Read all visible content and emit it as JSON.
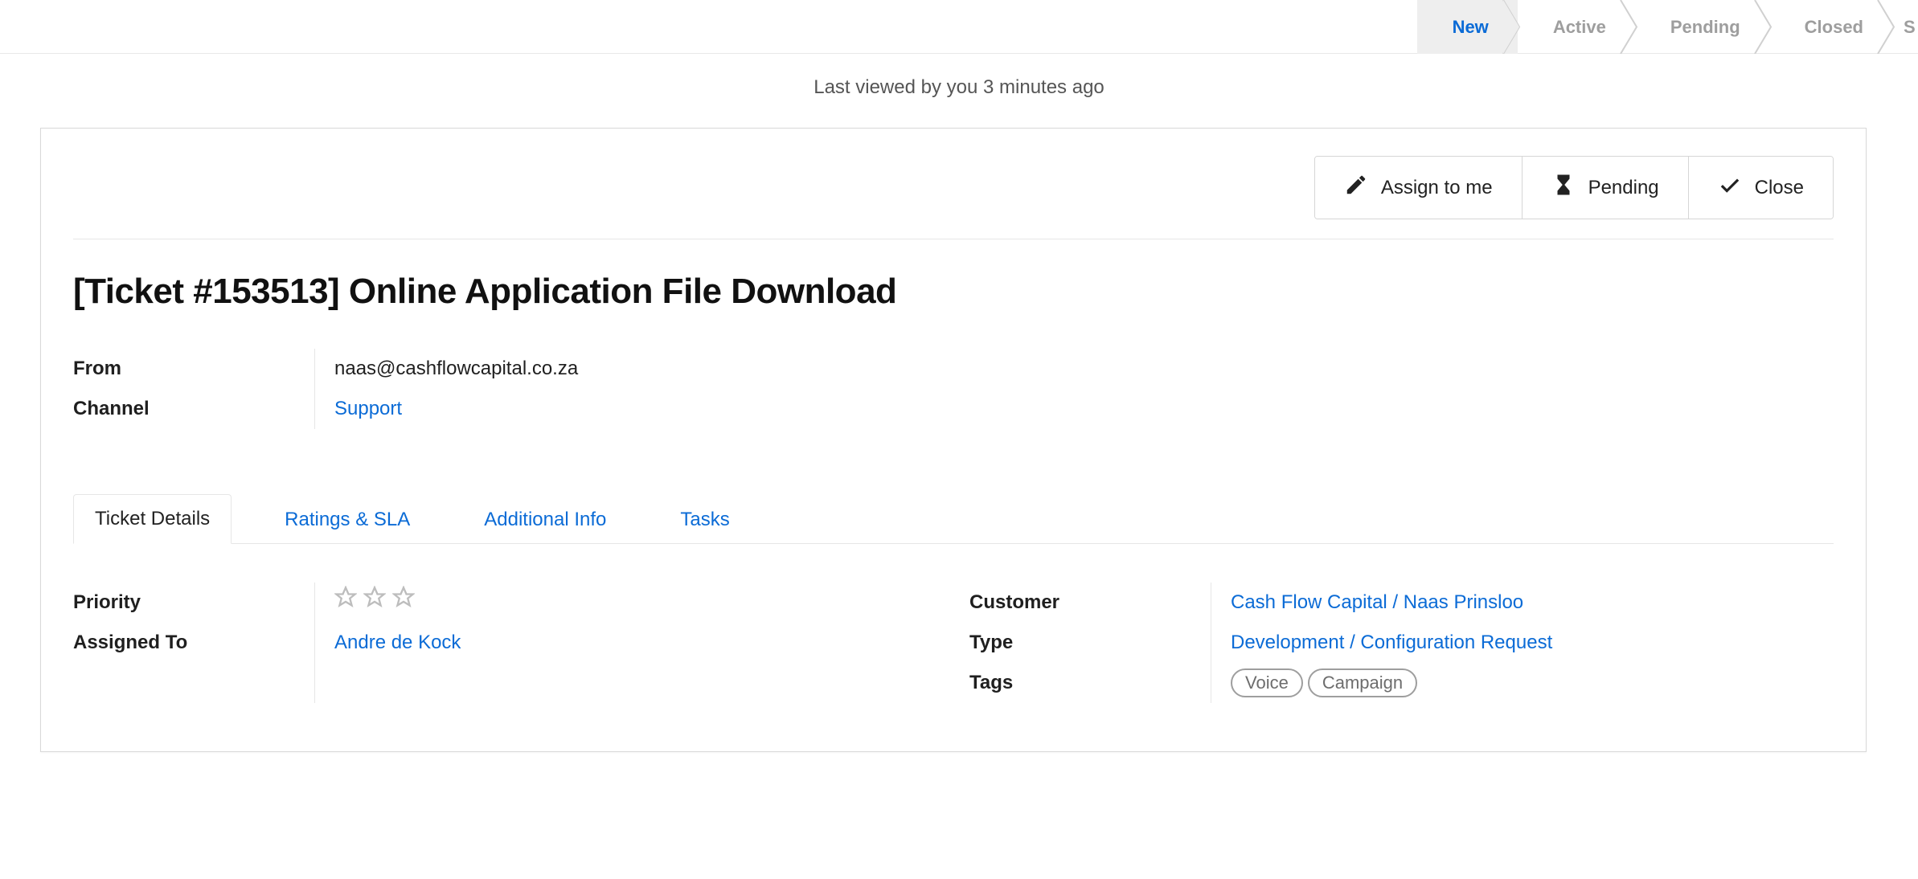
{
  "pipeline": {
    "steps": [
      "New",
      "Active",
      "Pending",
      "Closed"
    ],
    "stub": "S",
    "active_index": 0
  },
  "last_viewed": "Last viewed by you 3 minutes ago",
  "actions": {
    "assign": "Assign to me",
    "pending": "Pending",
    "close": "Close"
  },
  "ticket": {
    "title": "[Ticket #153513] Online Application File Download",
    "meta": {
      "from_label": "From",
      "from_value": "naas@cashflowcapital.co.za",
      "channel_label": "Channel",
      "channel_value": "Support"
    }
  },
  "tabs": {
    "items": [
      "Ticket Details",
      "Ratings & SLA",
      "Additional Info",
      "Tasks"
    ],
    "active_index": 0
  },
  "details": {
    "left": {
      "priority_label": "Priority",
      "assigned_label": "Assigned To",
      "assigned_value": "Andre de Kock"
    },
    "right": {
      "customer_label": "Customer",
      "customer_value": "Cash Flow Capital / Naas Prinsloo",
      "type_label": "Type",
      "type_value": "Development / Configuration Request",
      "tags_label": "Tags",
      "tags": [
        "Voice",
        "Campaign"
      ]
    }
  }
}
